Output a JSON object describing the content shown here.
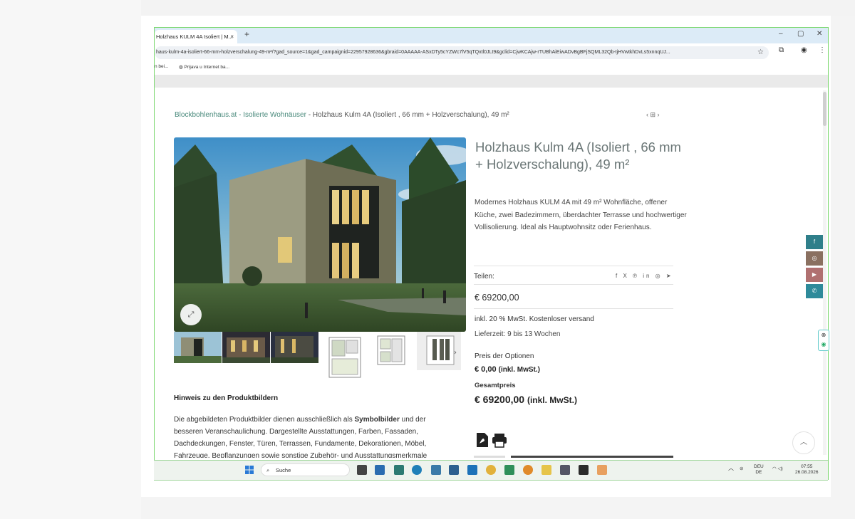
{
  "browser": {
    "tab_title": "Holzhaus KULM 4A Isoliert | M...",
    "tab_close": "×",
    "new_tab": "+",
    "window_controls": [
      "–",
      "▢",
      "✕"
    ],
    "address_url": "haus-kulm-4a-isoliert-66-mm-holzverschalung-49-m²/?gad_source=1&gad_campaignid=22957928636&gbraid=0AAAAA-ASxDTy5cYZWc7lV5qTQxtl0JLt9&gclid=CjwKCAjw-rTUBhAiEiwADvBgBFjSQML32Qb-tjHVwtkhDvLs5xnnqUJ...",
    "bookmarks": [
      "n bei...",
      "Prijava u Internet ba..."
    ]
  },
  "breadcrumb": {
    "site": "Blockbohlenhaus.at",
    "sep1": " - ",
    "category": "Isolierte Wohnäuser",
    "sep2": " - ",
    "current": "Holzhaus Kulm 4A (Isoliert , 66 mm + Holzverschalung), 49 m²",
    "nav": "‹  ⊞  ›"
  },
  "product": {
    "title": "Holzhaus Kulm 4A (Isoliert , 66 mm + Holzverschalung), 49 m²",
    "description": "Modernes Holzhaus KULM 4A mit 49 m² Wohnfläche, offener Küche, zwei Badezimmern, überdachter Terrasse und hochwertiger Vollisolierung. Ideal als Hauptwohnsitz oder Ferienhaus.",
    "share_label": "Teilen:",
    "share_icons": [
      "f",
      "X",
      "℗",
      "in",
      "◎",
      "➤"
    ],
    "price": "€   69200,00",
    "tax_info": "inkl. 20 % MwSt. Kostenloser versand",
    "delivery": "Lieferzeit: 9 bis 13 Wochen",
    "options_label": "Preis der Optionen",
    "options_price": "€ 0,00",
    "options_suffix": "(inkl. MwSt.)",
    "total_label": "Gesamtpreis",
    "total_price": "€ 69200,00",
    "total_suffix": "(inkl. MwSt.)"
  },
  "hint": {
    "title": "Hinweis zu den Produktbildern",
    "text_before": "Die abgebildeten Produktbilder dienen ausschließlich als ",
    "text_bold": "Symbolbilder",
    "text_after": " und der besseren Veranschaulichung. Dargestellte Ausstattungen, Farben, Fassaden, Dachdeckungen, Fenster, Türen, Terrassen, Fundamente, Dekorationen, Möbel, Fahrzeuge, Bepflanzungen sowie sonstige Zubehör- und Ausstattungsmerkmale"
  },
  "side_social": [
    "f",
    "◎",
    "▶",
    "✆"
  ],
  "taskbar": {
    "search": "Suche",
    "lang": "DEU",
    "lang2": "DE",
    "time": "07:55",
    "date": "26.08.2026"
  },
  "colors": {
    "accent": "#4a8a7c",
    "title_gray": "#6a7676",
    "facebook": "#2f7f8a",
    "instagram": "#8a7060",
    "youtube": "#b07070",
    "whatsapp": "#2e8a9a"
  }
}
